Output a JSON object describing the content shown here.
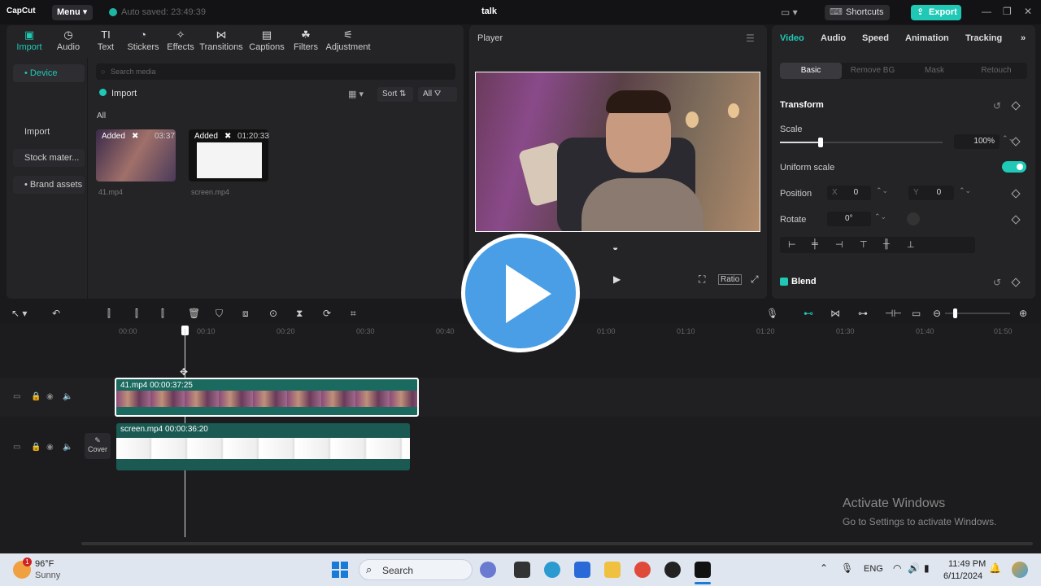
{
  "app": {
    "logo": "CapCut",
    "menu": "Menu",
    "autosave": "Auto saved: 23:49:39",
    "project_title": "talk",
    "shortcuts": "Shortcuts",
    "export": "Export"
  },
  "media_tabs": [
    {
      "label": "Import",
      "icon": "import-icon",
      "glyph": "▣"
    },
    {
      "label": "Audio",
      "icon": "audio-icon",
      "glyph": "◷"
    },
    {
      "label": "Text",
      "icon": "text-icon",
      "glyph": "TI"
    },
    {
      "label": "Stickers",
      "icon": "stickers-icon",
      "glyph": "◔"
    },
    {
      "label": "Effects",
      "icon": "effects-icon",
      "glyph": "✧"
    },
    {
      "label": "Transitions",
      "icon": "transitions-icon",
      "glyph": "⋈"
    },
    {
      "label": "Captions",
      "icon": "captions-icon",
      "glyph": "▤"
    },
    {
      "label": "Filters",
      "icon": "filters-icon",
      "glyph": "☘"
    },
    {
      "label": "Adjustment",
      "icon": "adjustment-icon",
      "glyph": "⚟"
    }
  ],
  "sidebar": {
    "items": [
      "• Device",
      "Import",
      "Stock mater...",
      "• Brand assets"
    ]
  },
  "media": {
    "search_placeholder": "Search media",
    "import": "Import",
    "sort": "Sort",
    "all_filter": "All",
    "all_heading": "All",
    "items": [
      {
        "badge": "Added",
        "duration": "03:37",
        "name": "41.mp4"
      },
      {
        "badge": "Added",
        "duration": "01:20:33",
        "name": "screen.mp4"
      }
    ]
  },
  "player": {
    "title": "Player",
    "ratio": "Ratio"
  },
  "props": {
    "tabs": [
      "Video",
      "Audio",
      "Speed",
      "Animation",
      "Tracking"
    ],
    "subtabs": [
      "Basic",
      "Remove BG",
      "Mask",
      "Retouch"
    ],
    "transform": "Transform",
    "scale_label": "Scale",
    "scale_value": "100%",
    "scale_level": 0.25,
    "uniform_scale": "Uniform scale",
    "position_label": "Position",
    "pos_x_label": "X",
    "pos_x": "0",
    "pos_y_label": "Y",
    "pos_y": "0",
    "rotate_label": "Rotate",
    "rotate_value": "0°",
    "blend": "Blend"
  },
  "timeline": {
    "ticks": [
      "00:00",
      "00:10",
      "00:20",
      "00:30",
      "00:40",
      "01:00",
      "01:10",
      "01:20",
      "01:30",
      "01:40",
      "01:50"
    ],
    "clip1_label": "41.mp4   00:00:37:25",
    "clip2_label": "screen.mp4   00:00:36:20",
    "cover": "Cover"
  },
  "watermark": {
    "line1": "Activate Windows",
    "line2": "Go to Settings to activate Windows."
  },
  "taskbar": {
    "weather_temp": "96°F",
    "weather_desc": "Sunny",
    "search": "Search",
    "lang": "ENG",
    "time": "11:49 PM",
    "date": "6/11/2024"
  },
  "colors": {
    "accent": "#1fc9b5",
    "play_overlay": "#4a9ee6"
  }
}
